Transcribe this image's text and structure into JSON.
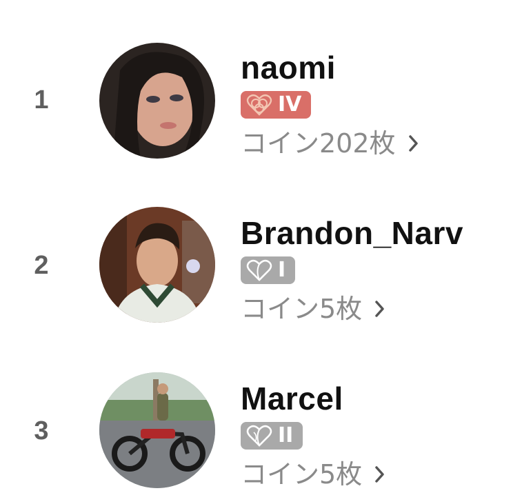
{
  "leaderboard": [
    {
      "rank": "1",
      "username": "naomi",
      "badge_level": "IV",
      "badge_color": "#d96f68",
      "badge_icon": "heart-knot-icon",
      "coins": "コイン202枚"
    },
    {
      "rank": "2",
      "username": "Brandon_Narv",
      "badge_level": "I",
      "badge_color": "#a9a9a9",
      "badge_icon": "heart-outline-icon",
      "coins": "コイン5枚"
    },
    {
      "rank": "3",
      "username": "Marcel",
      "badge_level": "II",
      "badge_color": "#a9a9a9",
      "badge_icon": "heart-outline-icon",
      "coins": "コイン5枚"
    }
  ]
}
